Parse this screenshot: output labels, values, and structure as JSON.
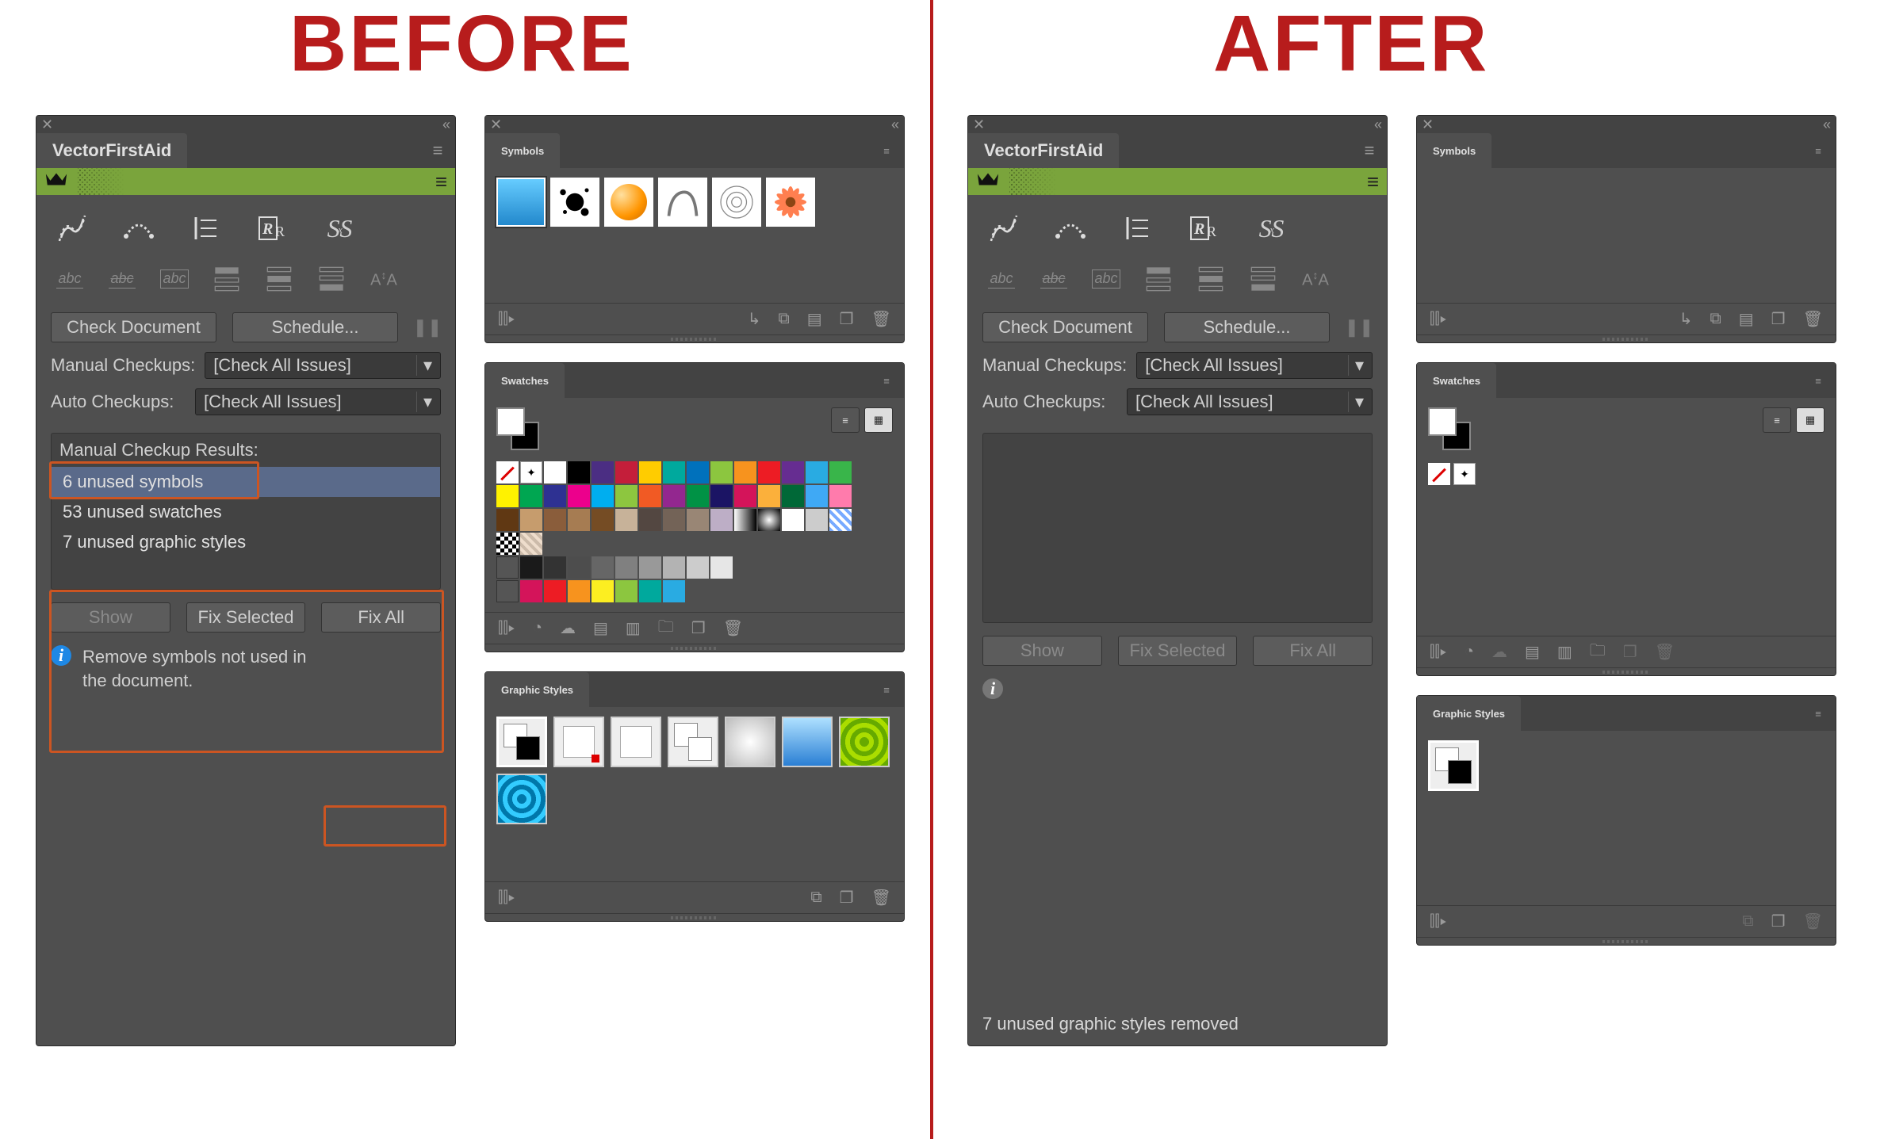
{
  "headings": {
    "before": "BEFORE",
    "after": "AFTER"
  },
  "vfa": {
    "title": "VectorFirstAid",
    "buttons": {
      "check_document": "Check Document",
      "schedule": "Schedule...",
      "show": "Show",
      "fix_selected": "Fix Selected",
      "fix_all": "Fix All"
    },
    "labels": {
      "manual_checkups": "Manual Checkups:",
      "auto_checkups": "Auto Checkups:",
      "manual_checkup_results": "Manual Checkup Results:"
    },
    "dropdowns": {
      "manual_value": "[Check All Issues]",
      "auto_value": "[Check All Issues]"
    },
    "results_before": [
      {
        "text": "6 unused symbols",
        "selected": true
      },
      {
        "text": "53 unused swatches",
        "selected": false
      },
      {
        "text": "7 unused graphic styles",
        "selected": false
      }
    ],
    "hint_before": "Remove symbols not used in the document.",
    "status_after": "7 unused graphic styles removed",
    "tool_icons_row1": [
      "path-cleanup-icon",
      "tangent-icon",
      "align-lines-icon",
      "rr-icon",
      "ss-icon"
    ],
    "tool_icons_row2": [
      "abc-icon",
      "abc-strike-icon",
      "abc-box-icon",
      "stack-top-icon",
      "stack-mid-icon",
      "stack-bot-icon",
      "aa-icon"
    ]
  },
  "symbols_panel": {
    "title": "Symbols",
    "thumbs_before": [
      "gradient-bar",
      "ink-splat",
      "orange-orb",
      "ribbon",
      "spiro",
      "gerbera"
    ],
    "thumbs_after": [],
    "footer_icons": [
      "library-icon",
      "place-icon",
      "break-link-icon",
      "options-icon",
      "duplicate-icon",
      "delete-icon"
    ]
  },
  "swatches_panel": {
    "title": "Swatches",
    "view_modes": [
      "list-view",
      "grid-view"
    ],
    "active_view": "grid-view",
    "row1": [
      "none",
      "reg",
      "#ffffff",
      "#000000",
      "#4b2e83",
      "#c41e3a",
      "#ffcc00",
      "#00a99d",
      "#0071bc",
      "#8cc63f",
      "#f7931e",
      "#ed1c24",
      "#662d91",
      "#29abe2",
      "#39b54a"
    ],
    "row2": [
      "#fff200",
      "#00a651",
      "#2e3192",
      "#ec008c",
      "#00aeef",
      "#8dc63f",
      "#f15a24",
      "#93278f",
      "#009245",
      "#1b1464",
      "#d4145a",
      "#fbb03b",
      "#006837",
      "#3fa9f5",
      "#ff7bac"
    ],
    "row3": [
      "#603813",
      "#c69c6d",
      "#8a5d3b",
      "#a67c52",
      "#754c24",
      "#c7b299",
      "#534741",
      "#736357",
      "#998675",
      "#bdaec6",
      "grad-h",
      "grad-r",
      "#ffffff",
      "#cccccc",
      "stripe"
    ],
    "row4_pattern": [
      "checker",
      "marble"
    ],
    "row5_greys": [
      "folder",
      "#1a1a1a",
      "#333333",
      "#4d4d4d",
      "#666666",
      "#808080",
      "#999999",
      "#b3b3b3",
      "#cccccc",
      "#e6e6e6"
    ],
    "row6_brights": [
      "folder",
      "#d4145a",
      "#ed1c24",
      "#f7931e",
      "#fcee21",
      "#8cc63f",
      "#00a99d",
      "#29abe2"
    ],
    "after_extra": [
      "none",
      "reg"
    ],
    "footer_icons": [
      "library-icon",
      "swatch-kind-icon",
      "cloud-icon",
      "options-icon",
      "group-icon",
      "new-folder-icon",
      "new-swatch-icon",
      "delete-icon"
    ]
  },
  "graphic_styles_panel": {
    "title": "Graphic Styles",
    "styles_before": [
      "default-style",
      "boxed-style",
      "framed-style",
      "split-style",
      "soft-grey-style",
      "blue-glass-style",
      "green-swirl-style",
      "blue-swirl-style"
    ],
    "styles_after": [
      "default-style"
    ],
    "footer_icons": [
      "library-icon",
      "break-link-icon",
      "new-style-icon",
      "delete-icon"
    ]
  },
  "colors": {
    "highlight": "#cc5522",
    "divider": "#b71c1c",
    "panel": "#4f4f4f",
    "green_strip": "#7aa43c"
  }
}
